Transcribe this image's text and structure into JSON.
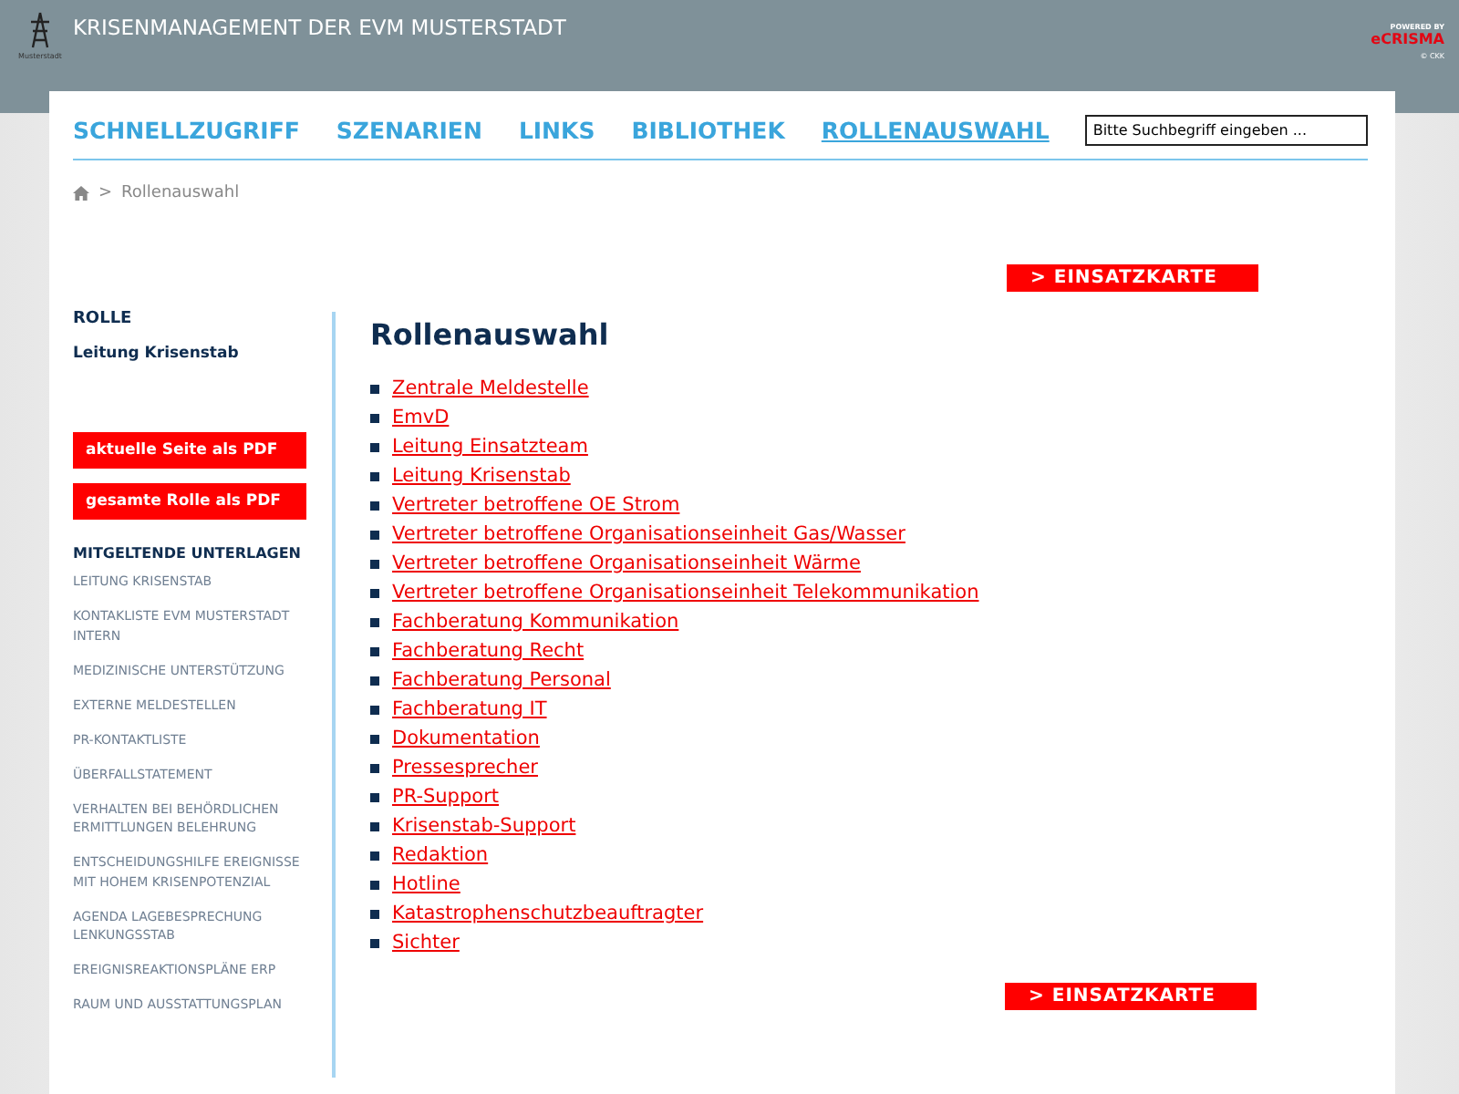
{
  "header": {
    "title": "KRISENMANAGEMENT DER EVM MUSTERSTADT",
    "logo_caption": "Musterstadt",
    "brand_powered": "POWERED BY",
    "brand_name": "eCRISMA",
    "brand_copyright": "© CKK"
  },
  "nav": [
    {
      "label": "SCHNELLZUGRIFF",
      "selected": false
    },
    {
      "label": "SZENARIEN",
      "selected": false
    },
    {
      "label": "LINKS",
      "selected": false
    },
    {
      "label": "BIBLIOTHEK",
      "selected": false
    },
    {
      "label": "ROLLENAUSWAHL",
      "selected": true
    }
  ],
  "search": {
    "placeholder": "Bitte Suchbegriff eingeben ..."
  },
  "breadcrumb": {
    "separator": ">",
    "current": "Rollenauswahl"
  },
  "einsatzkarte_buttons": [
    "> EINSATZKARTE",
    "> EINSATZKARTE"
  ],
  "sidebar": {
    "role_heading": "ROLLE",
    "role": "Leitung Krisenstab",
    "pdf_buttons": [
      "aktuelle Seite als PDF",
      "gesamte Rolle als PDF"
    ],
    "documents_heading": "MITGELTENDE UNTERLAGEN",
    "documents": [
      "LEITUNG KRISENSTAB",
      "KONTAKLISTE EVM MUSTERSTADT INTERN",
      "MEDIZINISCHE UNTERSTÜTZUNG",
      "EXTERNE MELDESTELLEN",
      "PR-KONTAKTLISTE",
      "ÜBERFALLSTATEMENT",
      "VERHALTEN BEI BEHÖRDLICHEN ERMITTLUNGEN BELEHRUNG",
      "ENTSCHEIDUNGSHILFE EREIGNISSE MIT HOHEM KRISENPOTENZIAL",
      "AGENDA LAGEBESPRECHUNG LENKUNGSSTAB",
      "EREIGNISREAKTIONSPLÄNE ERP",
      "RAUM UND AUSSTATTUNGSPLAN"
    ]
  },
  "main": {
    "heading": "Rollenauswahl",
    "roles": [
      "Zentrale Meldestelle",
      "EmvD",
      "Leitung Einsatzteam",
      "Leitung Krisenstab",
      "Vertreter betroffene OE Strom",
      "Vertreter betroffene Organisationseinheit Gas/Wasser",
      "Vertreter betroffene Organisationseinheit Wärme",
      "Vertreter betroffene Organisationseinheit Telekommunikation",
      "Fachberatung Kommunikation",
      "Fachberatung Recht",
      "Fachberatung Personal",
      "Fachberatung IT",
      "Dokumentation",
      "Pressesprecher",
      "PR-Support",
      "Krisenstab-Support",
      "Redaktion",
      "Hotline",
      "Katastrophenschutzbeauftragter",
      "Sichter"
    ]
  }
}
